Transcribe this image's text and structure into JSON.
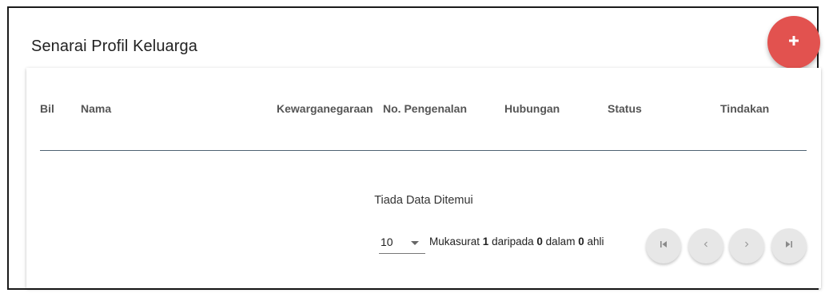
{
  "page": {
    "title": "Senarai Profil Keluarga"
  },
  "fab": {
    "icon": "plus-icon",
    "color": "#e2524f"
  },
  "table": {
    "columns": [
      "Bil",
      "Nama",
      "Kewarganegaraan",
      "No. Pengenalan",
      "Hubungan",
      "Status",
      "Tindakan"
    ],
    "rows": [],
    "empty_message": "Tiada Data Ditemui"
  },
  "pagination": {
    "rows_per_page": "10",
    "label_page": "Mukasurat",
    "current_page": "1",
    "label_of": "daripada",
    "total_pages": "0",
    "label_in": "dalam",
    "total_items": "0",
    "label_items": "ahli",
    "buttons": [
      "first-page-icon",
      "previous-page-icon",
      "next-page-icon",
      "last-page-icon"
    ]
  }
}
